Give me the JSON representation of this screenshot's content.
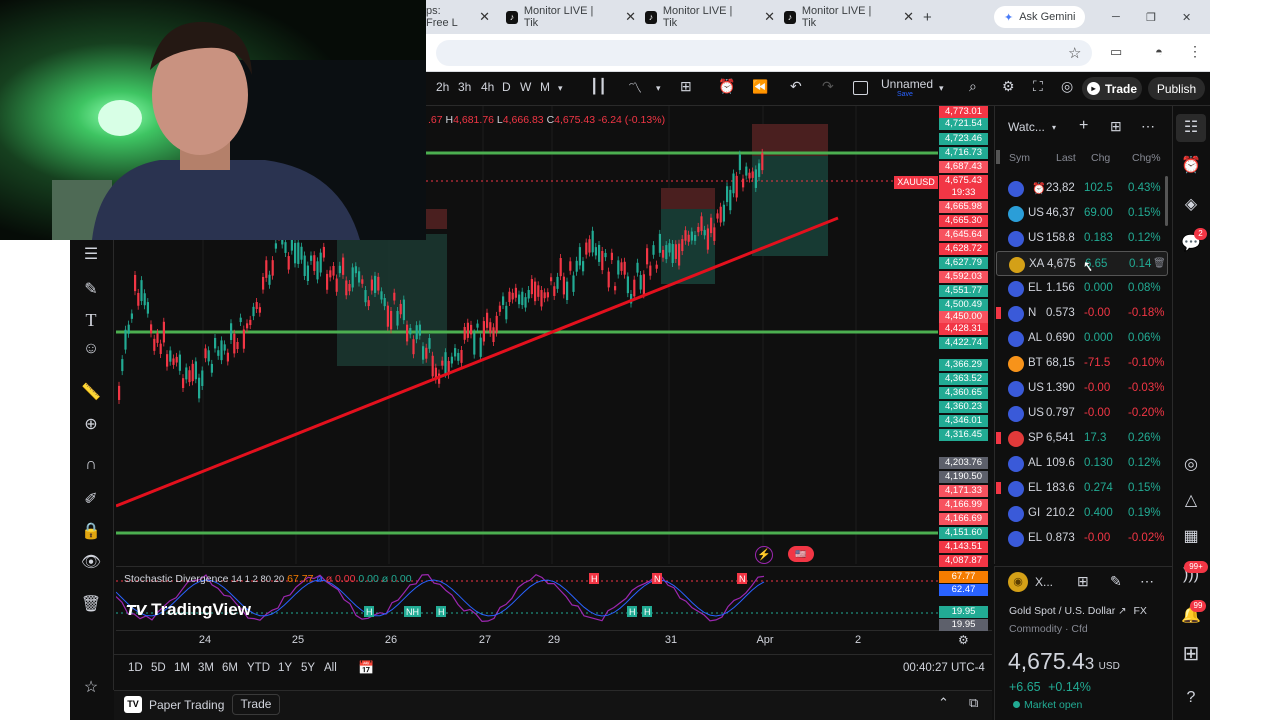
{
  "browser": {
    "tabs": [
      {
        "label": "ps: Free L"
      },
      {
        "label": "Monitor LIVE | Tik"
      },
      {
        "label": "Monitor LIVE | Tik"
      },
      {
        "label": "Monitor LIVE | Tik"
      }
    ],
    "ask_gemini": "Ask Gemini",
    "new_tab": "+",
    "window_min": "─",
    "window_max": "❐",
    "window_close": "✕"
  },
  "toolbar": {
    "intervals": [
      "2h",
      "3h",
      "4h",
      "D",
      "W",
      "M"
    ],
    "layout_name": "Unnamed",
    "layout_status": "Save",
    "trade": "Trade",
    "publish": "Publish"
  },
  "legend": {
    "h_label": "H",
    "h_value": "4,681.76",
    "l_label": "L",
    "l_value": "4,666.83",
    "c_label": "C",
    "c_value": "4,675.43",
    "change": "-6.24 (-0.13%)",
    "prefix": ".67"
  },
  "symbol_tag": "XAUUSD",
  "price_scale": {
    "labels": [
      {
        "text": "4,773.01",
        "color": "#f23645"
      },
      {
        "text": "4,721.54",
        "color": "#22ab94"
      },
      {
        "text": "4,723.46",
        "color": "#22ab94"
      },
      {
        "text": "4,716.73",
        "color": "#22ab94"
      },
      {
        "text": "4,687.43",
        "color": "#f7525f"
      },
      {
        "text": "4,675.43",
        "color": "#f23645"
      },
      {
        "text": "19:33",
        "color": "#f23645"
      },
      {
        "text": "4,665.98",
        "color": "#f7525f"
      },
      {
        "text": "4,665.30",
        "color": "#f23645"
      },
      {
        "text": "4,645.64",
        "color": "#f7525f"
      },
      {
        "text": "4,628.72",
        "color": "#f23645"
      },
      {
        "text": "4,627.79",
        "color": "#22ab94"
      },
      {
        "text": "4,592.03",
        "color": "#f7525f"
      },
      {
        "text": "4,551.77",
        "color": "#22ab94"
      },
      {
        "text": "4,500.49",
        "color": "#22ab94"
      },
      {
        "text": "4,450.00",
        "color": "#f7525f"
      },
      {
        "text": "4,428.31",
        "color": "#f23645"
      },
      {
        "text": "4,422.74",
        "color": "#22ab94"
      },
      {
        "text": "4,366.29",
        "color": "#22ab94"
      },
      {
        "text": "4,363.52",
        "color": "#22ab94"
      },
      {
        "text": "4,360.65",
        "color": "#22ab94"
      },
      {
        "text": "4,360.23",
        "color": "#22ab94"
      },
      {
        "text": "4,346.01",
        "color": "#22ab94"
      },
      {
        "text": "4,316.45",
        "color": "#22ab94"
      },
      {
        "text": "4,203.76",
        "color": "#5d606b"
      },
      {
        "text": "4,190.50",
        "color": "#5d606b"
      },
      {
        "text": "4,171.33",
        "color": "#f7525f"
      },
      {
        "text": "4,166.99",
        "color": "#f7525f"
      },
      {
        "text": "4,166.69",
        "color": "#f7525f"
      },
      {
        "text": "4,151.60",
        "color": "#22ab94"
      },
      {
        "text": "4,143.51",
        "color": "#f23645"
      },
      {
        "text": "4,087.87",
        "color": "#f23645"
      }
    ],
    "osc_labels": [
      {
        "text": "67.77",
        "color": "#f57c00"
      },
      {
        "text": "62.47",
        "color": "#2962ff"
      },
      {
        "text": "19.95",
        "color": "#22ab94"
      },
      {
        "text": "19.95",
        "color": "#5d606b"
      }
    ]
  },
  "oscillator": {
    "name": "Stochastic Divergence",
    "params": "14 1 2 80 20",
    "v1": "67.77",
    "v2": "ø",
    "v3": "ø",
    "v4": "0.00",
    "v5": "0.00",
    "v6": "ø",
    "v7": "0.00",
    "markers_h": "H",
    "markers_n": "N",
    "markers_nh": "NH"
  },
  "watermark": "TradingView",
  "time_axis": [
    "24",
    "25",
    "26",
    "27",
    "29",
    "31",
    "Apr",
    "2"
  ],
  "ranges": [
    "1D",
    "5D",
    "1M",
    "3M",
    "6M",
    "YTD",
    "1Y",
    "5Y",
    "All"
  ],
  "clock": "00:40:27 UTC-4",
  "bottom": {
    "paper_trading": "Paper Trading",
    "trade": "Trade"
  },
  "watchlist": {
    "title": "Watc...",
    "headers": {
      "sym": "Sym",
      "last": "Last",
      "chg": "Chg",
      "chgp": "Chg%"
    },
    "rows": [
      {
        "sym": "",
        "last": "23,82",
        "chg": "102.5",
        "chgp": "0.43%",
        "up": true,
        "icon_color": "#3a5ad9"
      },
      {
        "sym": "US",
        "last": "46,37",
        "chg": "69.00",
        "chgp": "0.15%",
        "up": true,
        "icon_color": "#2b9ed8"
      },
      {
        "sym": "US",
        "last": "158.8",
        "chg": "0.183",
        "chgp": "0.12%",
        "up": true,
        "icon_color": "#3a5ad9"
      },
      {
        "sym": "XA",
        "last": "4,675",
        "chg": "6.65",
        "chgp": "0.14",
        "up": true,
        "icon_color": "#d4a017"
      },
      {
        "sym": "EL",
        "last": "1.156",
        "chg": "0.000",
        "chgp": "0.08%",
        "up": true,
        "icon_color": "#3a5ad9"
      },
      {
        "sym": "N",
        "last": "0.573",
        "chg": "-0.00",
        "chgp": "-0.18%",
        "up": false,
        "icon_color": "#3a5ad9"
      },
      {
        "sym": "AL",
        "last": "0.690",
        "chg": "0.000",
        "chgp": "0.06%",
        "up": true,
        "icon_color": "#3a5ad9"
      },
      {
        "sym": "BT",
        "last": "68,15",
        "chg": "-71.5",
        "chgp": "-0.10%",
        "up": false,
        "icon_color": "#f7931a"
      },
      {
        "sym": "US",
        "last": "1.390",
        "chg": "-0.00",
        "chgp": "-0.03%",
        "up": false,
        "icon_color": "#3a5ad9"
      },
      {
        "sym": "US",
        "last": "0.797",
        "chg": "-0.00",
        "chgp": "-0.20%",
        "up": false,
        "icon_color": "#3a5ad9"
      },
      {
        "sym": "SP",
        "last": "6,541",
        "chg": "17.3",
        "chgp": "0.26%",
        "up": true,
        "icon_color": "#e03a3a"
      },
      {
        "sym": "AL",
        "last": "109.6",
        "chg": "0.130",
        "chgp": "0.12%",
        "up": true,
        "icon_color": "#3a5ad9"
      },
      {
        "sym": "EL",
        "last": "183.6",
        "chg": "0.274",
        "chgp": "0.15%",
        "up": true,
        "icon_color": "#3a5ad9"
      },
      {
        "sym": "GI",
        "last": "210.2",
        "chg": "0.400",
        "chgp": "0.19%",
        "up": true,
        "icon_color": "#3a5ad9"
      },
      {
        "sym": "EL",
        "last": "0.873",
        "chg": "-0.00",
        "chgp": "-0.02%",
        "up": false,
        "icon_color": "#3a5ad9"
      }
    ]
  },
  "detail": {
    "short_name": "X...",
    "full_name": "Gold Spot / U.S. Dollar",
    "exchange": "FX",
    "category": "Commodity · Cfd",
    "price_main": "4,675.4",
    "price_last": "3",
    "currency": "USD",
    "change": "+6.65",
    "change_pct": "+0.14%",
    "status": "Market open"
  },
  "badges": {
    "notif_ideas": "2",
    "notif_alerts": "99+",
    "notif_bell": "99"
  },
  "colors": {
    "up": "#22ab94",
    "down": "#f23645",
    "trendline": "#e3101d",
    "levels": "#4caf50",
    "accent": "#2962ff"
  }
}
